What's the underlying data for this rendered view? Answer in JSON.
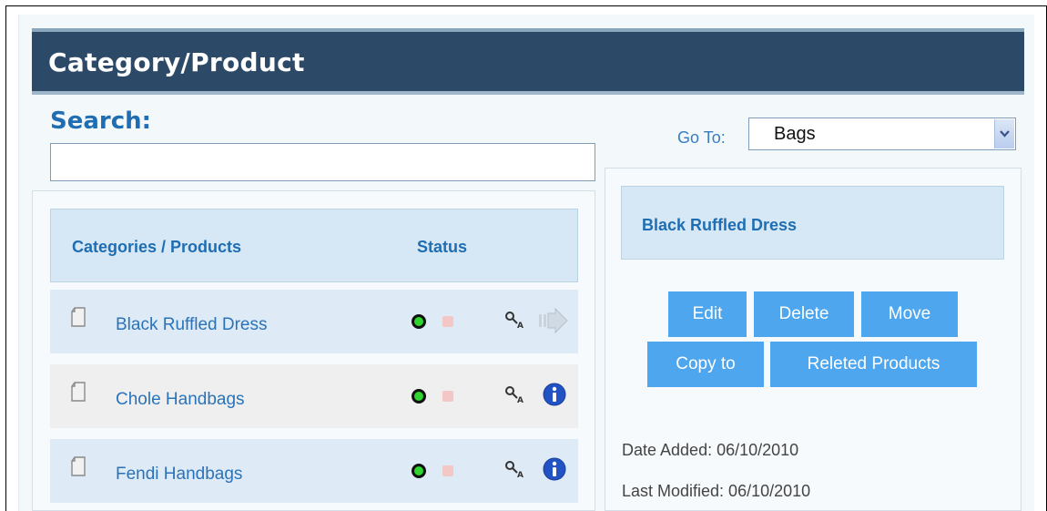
{
  "header": {
    "title": "Category/Product"
  },
  "search": {
    "label": "Search:",
    "value": "",
    "placeholder": ""
  },
  "goto": {
    "label": "Go To:",
    "selected": "Bags"
  },
  "list": {
    "columns": {
      "category": "Categories / Products",
      "status": "Status"
    },
    "rows": [
      {
        "name": "Black Ruffled Dress",
        "active": true,
        "action_icon": "arrow-right-icon"
      },
      {
        "name": "Chole Handbags",
        "active": true,
        "action_icon": "info-icon"
      },
      {
        "name": "Fendi Handbags",
        "active": true,
        "action_icon": "info-icon"
      }
    ]
  },
  "detail": {
    "title": "Black Ruffled Dress",
    "buttons": {
      "edit": "Edit",
      "delete": "Delete",
      "move": "Move",
      "copy_to": "Copy to",
      "related": "Releted Products"
    },
    "date_added": "Date Added: 06/10/2010",
    "last_modified": "Last Modified: 06/10/2010"
  },
  "colors": {
    "header_bg": "#2c4a68",
    "accent_text": "#1f6db2",
    "button_bg": "#4ea6ee",
    "status_active": "#2fd42f",
    "status_inactive": "#f4c7c7"
  }
}
